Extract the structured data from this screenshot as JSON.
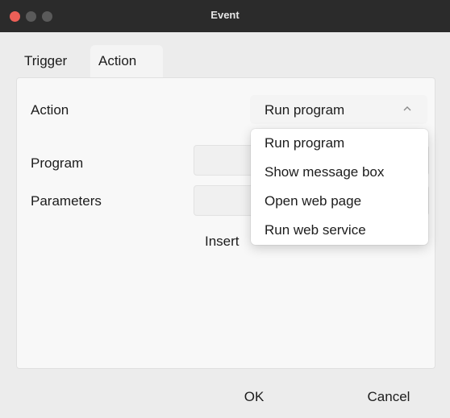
{
  "window": {
    "title": "Event"
  },
  "tabs": [
    {
      "label": "Trigger",
      "selected": false
    },
    {
      "label": "Action",
      "selected": true
    }
  ],
  "form": {
    "action_label": "Action",
    "program_label": "Program",
    "parameters_label": "Parameters",
    "action_value": "Run program",
    "insert_label": "Insert"
  },
  "dropdown": {
    "options": [
      "Run program",
      "Show message box",
      "Open web page",
      "Run web service"
    ]
  },
  "footer": {
    "ok_label": "OK",
    "cancel_label": "Cancel"
  },
  "icons": {
    "chevron": "chevron-up-icon"
  },
  "colors": {
    "titlebar": "#2b2b2b",
    "close_button": "#ec5f57"
  }
}
